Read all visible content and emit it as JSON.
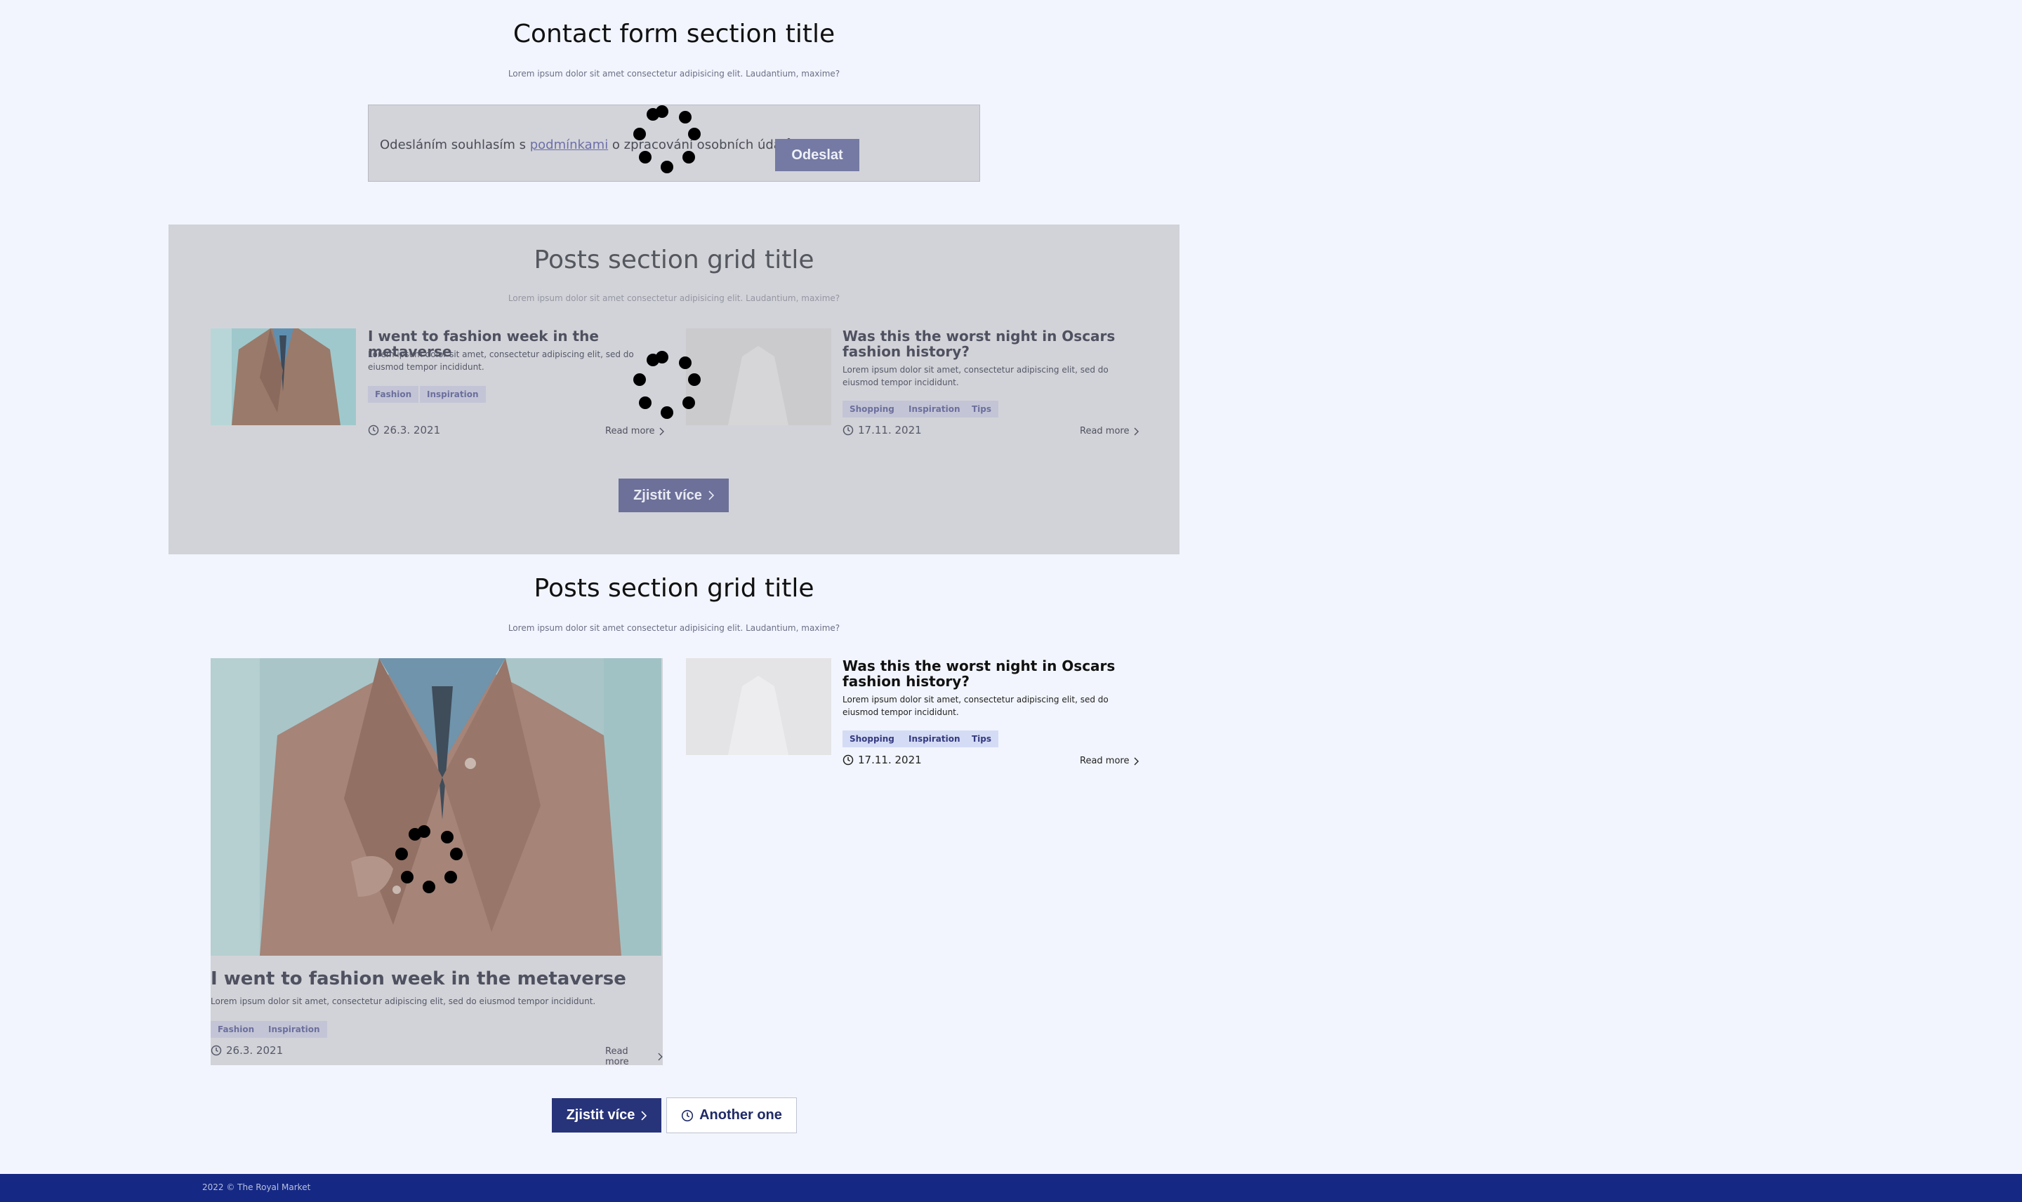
{
  "contact_form": {
    "title": "Contact form section title",
    "subtitle": "Lorem ipsum dolor sit amet consectetur adipisicing elit. Laudantium, maxime?",
    "consent_prefix": "Odesláním souhlasím s ",
    "consent_link": "podmínkami",
    "consent_suffix": " o zpracování osobních údajů.",
    "submit_label": "Odeslat"
  },
  "posts_grid_1": {
    "title": "Posts section grid title",
    "subtitle": "Lorem ipsum dolor sit amet consectetur adipisicing elit. Laudantium, maxime?",
    "posts": [
      {
        "title": "I went to fashion week in the metaverse",
        "excerpt": "Lorem ipsum dolor sit amet, consectetur adipiscing elit, sed do eiusmod tempor incididunt.",
        "tags": [
          "Fashion",
          "Inspiration"
        ],
        "date": "26.3. 2021",
        "read_more": "Read more"
      },
      {
        "title": "Was this the worst night in Oscars fashion history?",
        "excerpt": "Lorem ipsum dolor sit amet, consectetur adipiscing elit, sed do eiusmod tempor incididunt.",
        "tags": [
          "Shopping",
          "Inspiration",
          "Tips"
        ],
        "date": "17.11. 2021",
        "read_more": "Read more"
      }
    ],
    "more_label": "Zjistit více"
  },
  "posts_grid_2": {
    "title": "Posts section grid title",
    "subtitle": "Lorem ipsum dolor sit amet consectetur adipisicing elit. Laudantium, maxime?",
    "featured": {
      "title": "I went to fashion week in the metaverse",
      "excerpt": "Lorem ipsum dolor sit amet, consectetur adipiscing elit, sed do eiusmod tempor incididunt.",
      "tags": [
        "Fashion",
        "Inspiration"
      ],
      "date": "26.3. 2021",
      "read_more": "Read more"
    },
    "side": {
      "title": "Was this the worst night in Oscars fashion history?",
      "excerpt": "Lorem ipsum dolor sit amet, consectetur adipiscing elit, sed do eiusmod tempor incididunt.",
      "tags": [
        "Shopping",
        "Inspiration",
        "Tips"
      ],
      "date": "17.11. 2021",
      "read_more": "Read more"
    },
    "more_label": "Zjistit více",
    "another_label": "Another one"
  },
  "footer": {
    "copyright": "2022 © The Royal Market"
  },
  "colors": {
    "primary": "#283479",
    "footer": "#152883",
    "page_bg": "#f2f5fd",
    "overlay": "#d2d3d8"
  }
}
